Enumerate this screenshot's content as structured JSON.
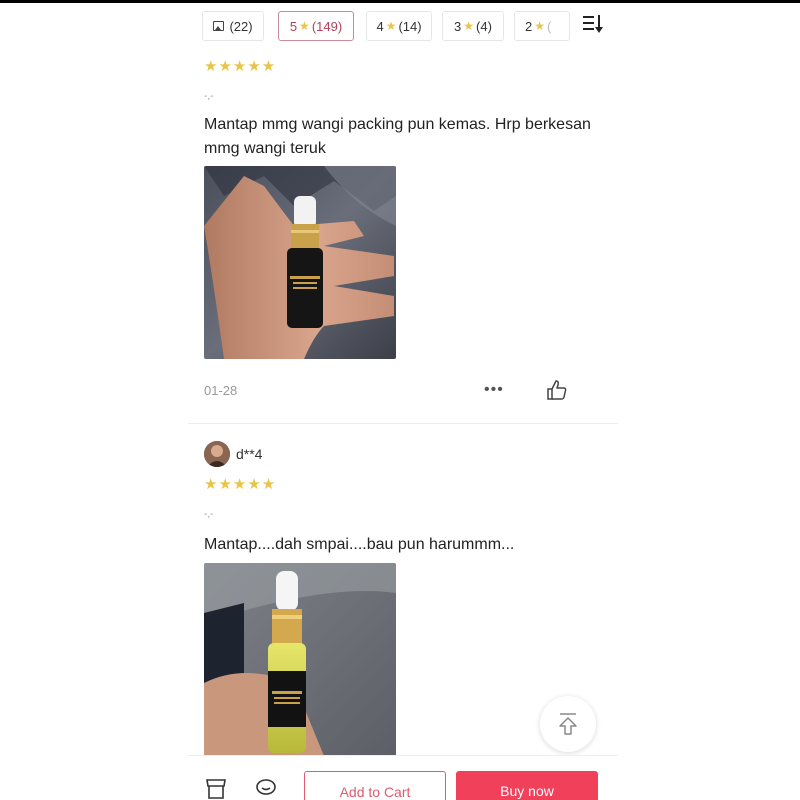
{
  "filters": [
    {
      "label": "(22)",
      "icon": "image-icon",
      "active": false
    },
    {
      "label": "5★ (149)",
      "rating": "5",
      "count": "(149)",
      "active": true
    },
    {
      "label": "4★ (14)",
      "rating": "4",
      "count": "(14)",
      "active": false
    },
    {
      "label": "3★ (4)",
      "rating": "3",
      "count": "(4)",
      "active": false
    },
    {
      "label": "2★ (",
      "rating": "2",
      "count": "(",
      "active": false
    }
  ],
  "star_glyph": "★",
  "reviews": [
    {
      "username": "",
      "stars": "★★★★★",
      "variant": "-,-",
      "text": "Mantap mmg wangi packing pun kemas. Hrp berkesan mmg wangi teruk",
      "date": "01-28",
      "more": "•••"
    },
    {
      "username": "d**4",
      "stars": "★★★★★",
      "variant": "-,-",
      "text": "Mantap....dah smpai....bau pun harummm...",
      "date": "",
      "more": ""
    }
  ],
  "bottom_bar": {
    "add_to_cart": "Add to Cart",
    "buy_now": "Buy now"
  },
  "colors": {
    "accent": "#f0405a",
    "star": "#e8c54a",
    "active_chip": "#b0405a"
  }
}
